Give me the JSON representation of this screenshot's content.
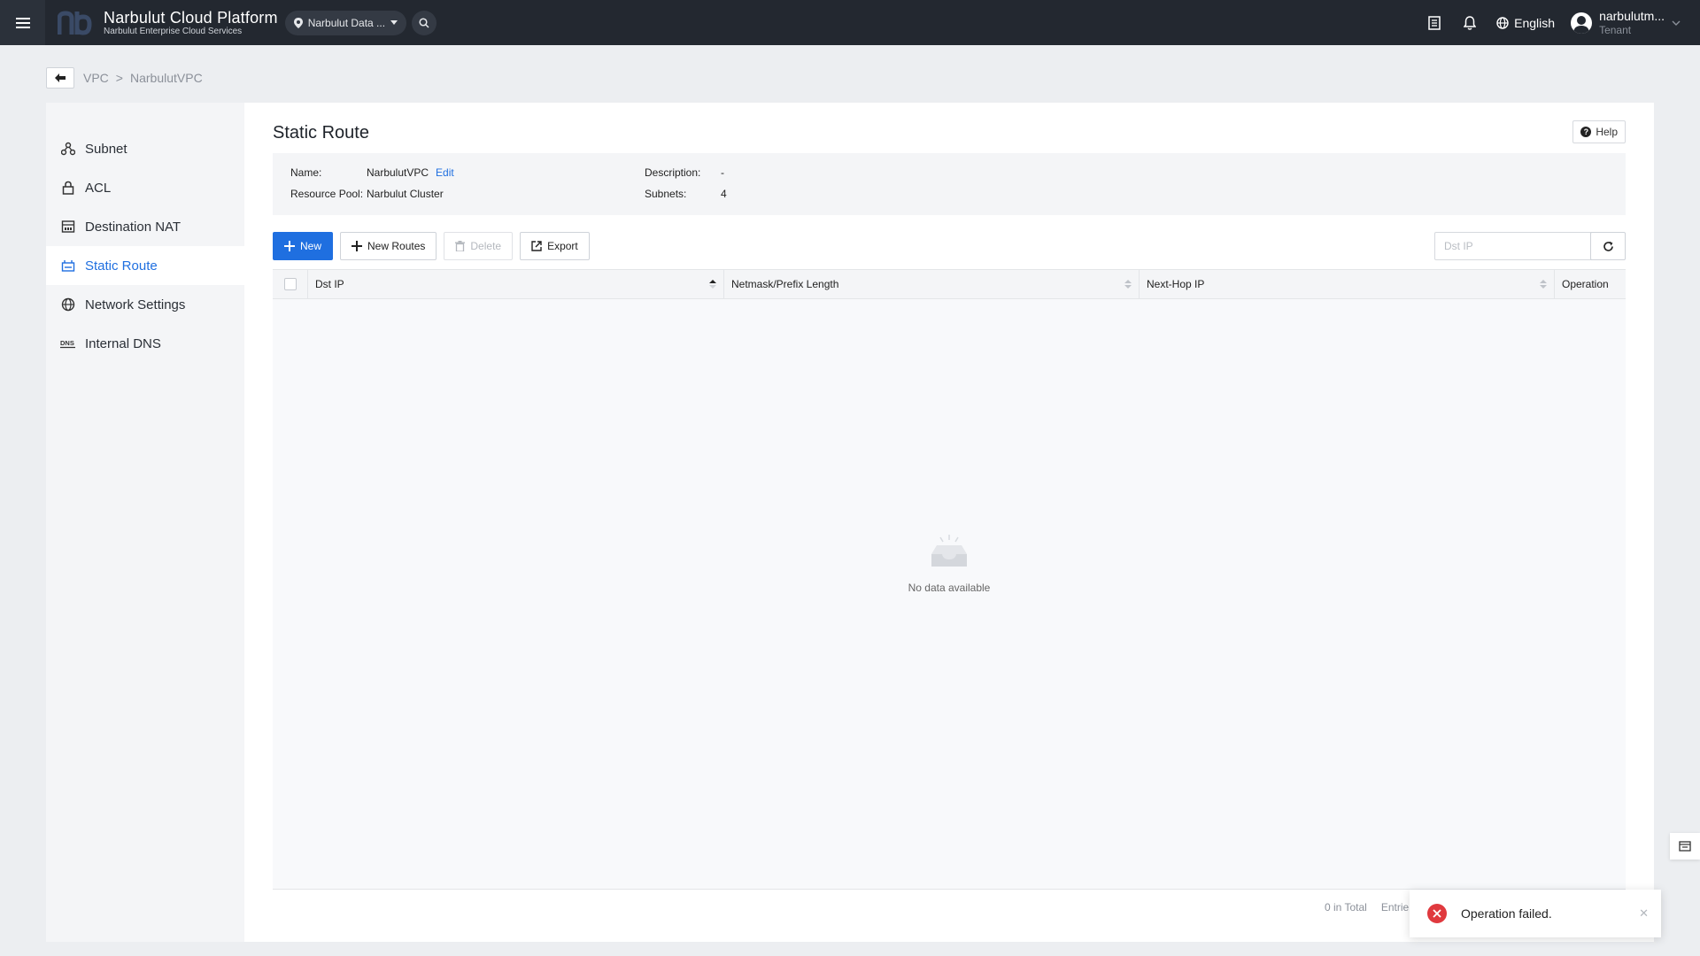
{
  "header": {
    "title": "Narbulut Cloud Platform",
    "subtitle": "Narbulut Enterprise Cloud Services",
    "datacenter": "Narbulut Data ...",
    "language": "English",
    "user_name": "narbulutm...",
    "user_role": "Tenant"
  },
  "breadcrumb": {
    "items": [
      "VPC",
      "NarbulutVPC"
    ],
    "separator": ">"
  },
  "sidebar": {
    "items": [
      {
        "label": "Subnet",
        "icon": "subnet-icon"
      },
      {
        "label": "ACL",
        "icon": "lock-icon"
      },
      {
        "label": "Destination NAT",
        "icon": "nat-icon"
      },
      {
        "label": "Static Route",
        "icon": "route-icon",
        "active": true
      },
      {
        "label": "Network Settings",
        "icon": "globe-icon"
      },
      {
        "label": "Internal DNS",
        "icon": "dns-icon"
      }
    ]
  },
  "page": {
    "title": "Static Route",
    "help_label": "Help"
  },
  "info": {
    "name_label": "Name:",
    "name_value": "NarbulutVPC",
    "edit_label": "Edit",
    "pool_label": "Resource Pool:",
    "pool_value": "Narbulut Cluster",
    "desc_label": "Description:",
    "desc_value": "-",
    "subnets_label": "Subnets:",
    "subnets_value": "4"
  },
  "toolbar": {
    "new_label": "New",
    "new_routes_label": "New Routes",
    "delete_label": "Delete",
    "export_label": "Export"
  },
  "search": {
    "placeholder": "Dst IP"
  },
  "table": {
    "columns": [
      "Dst IP",
      "Netmask/Prefix Length",
      "Next-Hop IP",
      "Operation"
    ],
    "empty_text": "No data available"
  },
  "pager": {
    "total": "0 in Total",
    "entries": "Entrie"
  },
  "toast": {
    "message": "Operation failed."
  },
  "colors": {
    "accent": "#1f6fe0",
    "topbar": "#232830",
    "error": "#e0393e"
  }
}
